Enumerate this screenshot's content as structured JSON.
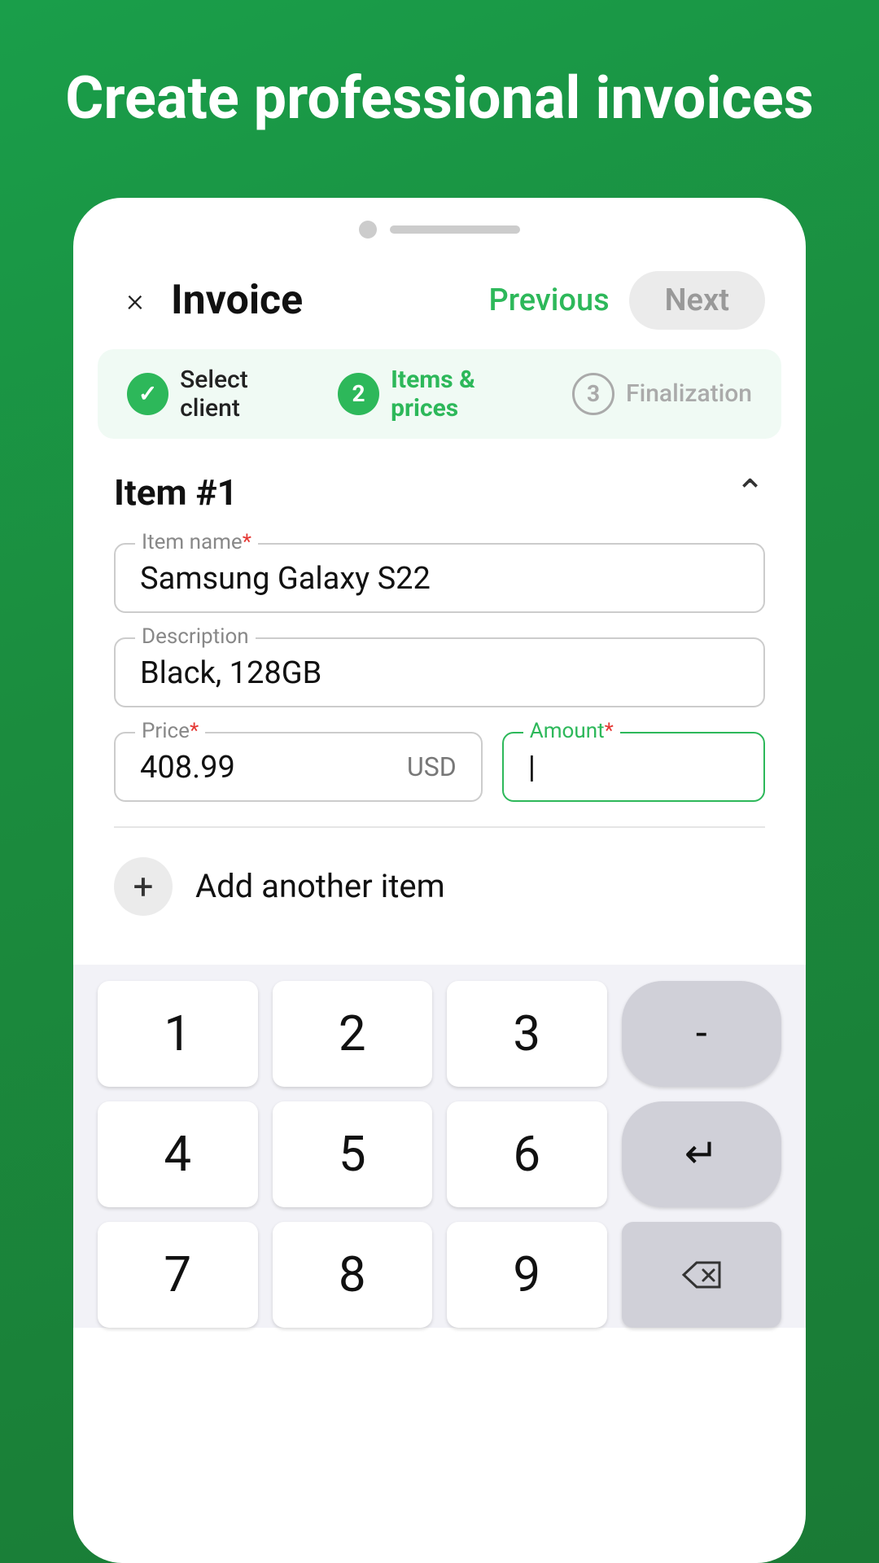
{
  "header": {
    "title": "Create professional invoices"
  },
  "card": {
    "close_label": "×",
    "invoice_title": "Invoice",
    "previous_label": "Previous",
    "next_label": "Next"
  },
  "steps": [
    {
      "id": 1,
      "label": "Select client",
      "state": "done",
      "icon": "✓"
    },
    {
      "id": 2,
      "label": "Items & prices",
      "state": "active"
    },
    {
      "id": 3,
      "label": "Finalization",
      "state": "inactive"
    }
  ],
  "item": {
    "title": "Item #1",
    "fields": {
      "name": {
        "label": "Item name",
        "required": true,
        "value": "Samsung Galaxy S22"
      },
      "description": {
        "label": "Description",
        "required": false,
        "value": "Black, 128GB"
      },
      "price": {
        "label": "Price",
        "required": true,
        "value": "408.99",
        "currency": "USD"
      },
      "amount": {
        "label": "Amount",
        "required": true,
        "value": ""
      }
    }
  },
  "add_item": {
    "icon": "+",
    "label": "Add another item"
  },
  "keyboard": {
    "rows": [
      [
        "1",
        "2",
        "3",
        "-"
      ],
      [
        "4",
        "5",
        "6",
        "↵"
      ],
      [
        "7",
        "8",
        "9",
        "⌫"
      ]
    ]
  }
}
